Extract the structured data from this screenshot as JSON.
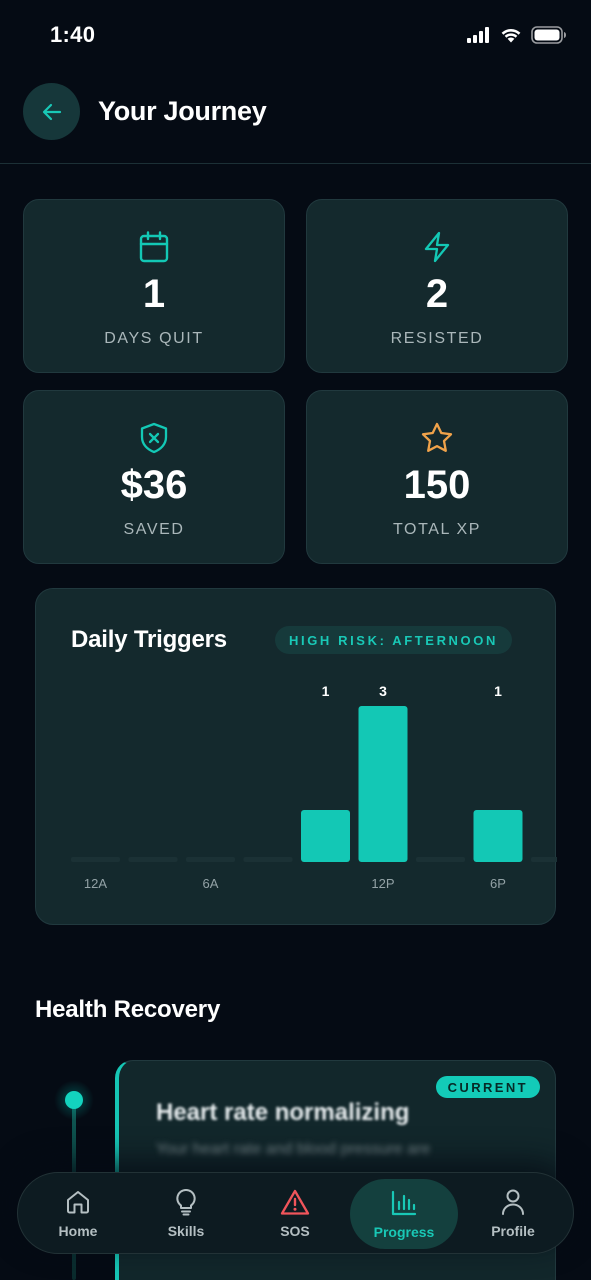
{
  "status_bar": {
    "time": "1:40"
  },
  "header": {
    "title": "Your Journey"
  },
  "stats": [
    {
      "icon": "calendar-icon",
      "value": "1",
      "label": "DAYS QUIT"
    },
    {
      "icon": "lightning-icon",
      "value": "2",
      "label": "RESISTED"
    },
    {
      "icon": "shield-x-icon",
      "value": "$36",
      "label": "SAVED"
    },
    {
      "icon": "star-icon",
      "value": "150",
      "label": "TOTAL XP"
    }
  ],
  "colors": {
    "accent": "#13c8b5",
    "star": "#f0a24a",
    "sos": "#f0555b",
    "card": "#14292d",
    "background": "#050b14"
  },
  "daily_triggers": {
    "title": "Daily Triggers",
    "badge": "HIGH RISK: AFTERNOON"
  },
  "chart_data": {
    "type": "bar",
    "title": "Daily Triggers",
    "categories": [
      "12A",
      "",
      "6A",
      "",
      "",
      "12P",
      "",
      "6P",
      ""
    ],
    "values": [
      0,
      0,
      0,
      0,
      1,
      3,
      0,
      1,
      0
    ],
    "tick_labels": [
      "12A",
      "6A",
      "12P",
      "6P"
    ],
    "ylim": [
      0,
      3
    ],
    "grid": false,
    "data_labels": "shown on non-zero bars"
  },
  "health": {
    "section_title": "Health Recovery",
    "current_badge": "CURRENT",
    "item_title": "Heart rate normalizing",
    "item_desc": "Your heart rate and blood pressure are"
  },
  "nav": [
    {
      "label": "Home",
      "icon": "home-icon",
      "active": false
    },
    {
      "label": "Skills",
      "icon": "lightbulb-icon",
      "active": false
    },
    {
      "label": "SOS",
      "icon": "warning-icon",
      "active": false
    },
    {
      "label": "Progress",
      "icon": "bar-chart-icon",
      "active": true
    },
    {
      "label": "Profile",
      "icon": "user-icon",
      "active": false
    }
  ]
}
